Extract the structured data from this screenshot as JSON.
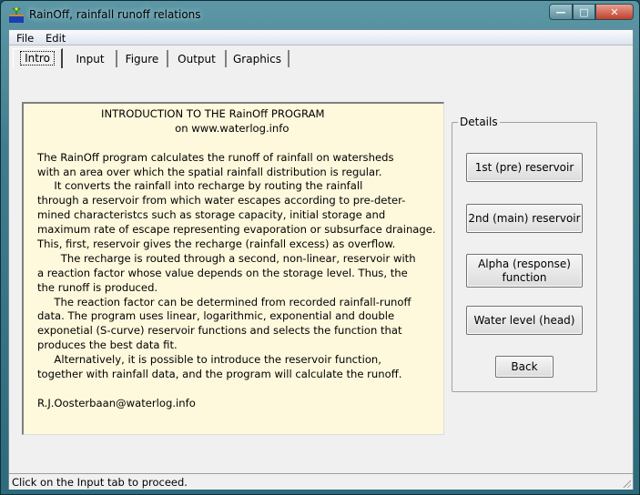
{
  "window": {
    "title": "RainOff, rainfall runoff relations",
    "controls": {
      "minimize": "—",
      "maximize": "□",
      "close": "✕"
    }
  },
  "menu": [
    "File",
    "Edit"
  ],
  "tabs": [
    {
      "label": "Intro",
      "active": true
    },
    {
      "label": "Input"
    },
    {
      "label": "Figure"
    },
    {
      "label": "Output"
    },
    {
      "label": "Graphics"
    }
  ],
  "intro": {
    "lines": [
      "                   INTRODUCTION TO THE RainOff PROGRAM",
      "                                         on www.waterlog.info",
      "",
      "The RainOff program calculates the runoff of rainfall on watersheds",
      "with an area over which the spatial rainfall distribution is regular.",
      "     It converts the rainfall into recharge by routing the rainfall",
      "through a reservoir from which water escapes according to pre-deter-",
      "mined characteristcs such as storage capacity, initial storage and",
      "maximum rate of escape representing evaporation or subsurface drainage.",
      "This, first, reservoir gives the recharge (rainfall excess) as overflow.",
      "       The recharge is routed through a second, non-linear, reservoir with",
      "a reaction factor whose value depends on the storage level. Thus, the",
      "the runoff is produced.",
      "     The reaction factor can be determined from recorded rainfall-runoff",
      "data. The program uses linear, logarithmic, exponential and double",
      "exponetial (S-curve) reservoir functions and selects the function that",
      "produces the best data fit.",
      "     Alternatively, it is possible to introduce the reservoir function,",
      "together with rainfall data, and the program will calculate the runoff.",
      "",
      "R.J.Oosterbaan@waterlog.info"
    ]
  },
  "details": {
    "label": "Details",
    "buttons": [
      "1st (pre) reservoir",
      "2nd (main) reservoir",
      "Alpha (response)\nfunction",
      "Water level (head)"
    ],
    "back": "Back"
  },
  "status": "Click on the Input tab to proceed."
}
